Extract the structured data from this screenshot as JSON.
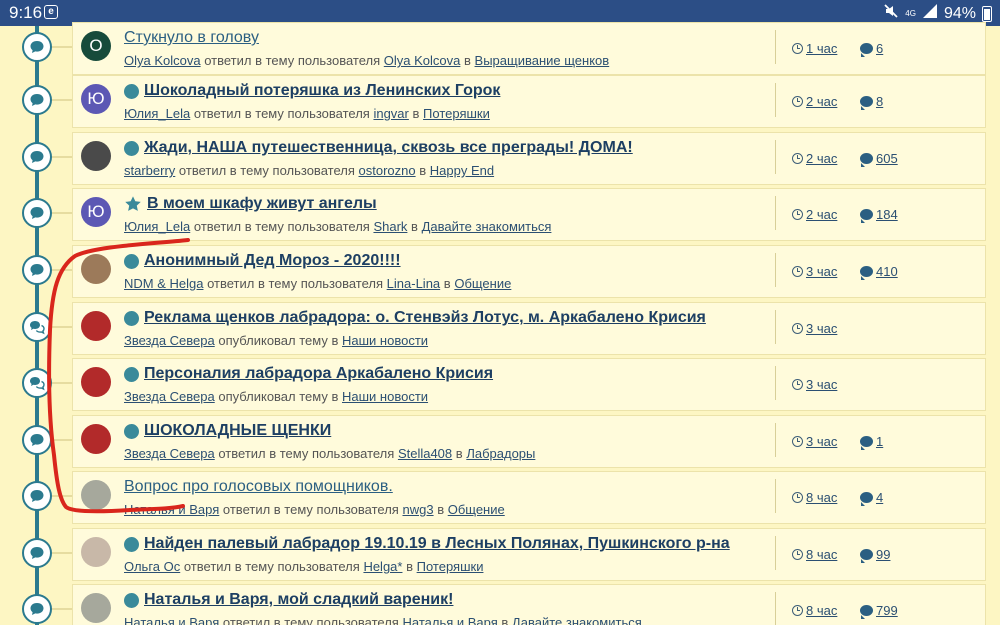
{
  "status_bar": {
    "time": "9:16",
    "app_icon": "e",
    "network": "4G",
    "battery": "94%",
    "icons": [
      "app-notification-icon",
      "mute-icon",
      "signal-icon",
      "battery-icon"
    ]
  },
  "colors": {
    "background": "#fdf6c3",
    "card": "#fffbdb",
    "timeline": "#2b7a8e",
    "status_bar": "#2c4e86",
    "annotation": "#d9261c"
  },
  "topics": [
    {
      "title": "Стукнуло в голову",
      "title_style": "normal",
      "marker": "none",
      "avatar_letter": "O",
      "avatar_color": "#174b3b",
      "author": "Olya Kolcova",
      "action": "ответил в тему пользователя",
      "topic_owner": "Olya Kolcova",
      "in_word": "в",
      "forum": "Выращивание щенков",
      "time": "1 час",
      "replies": "6",
      "node_icon": "comment-icon"
    },
    {
      "title": "Шоколадный потеряшка из Ленинских Горок",
      "title_style": "bold",
      "marker": "dot",
      "avatar_letter": "Ю",
      "avatar_color": "#5c58b4",
      "author": "Юлия_Lela",
      "action": "ответил в тему пользователя",
      "topic_owner": "ingvar",
      "in_word": "в",
      "forum": "Потеряшки",
      "time": "2 час",
      "replies": "8",
      "node_icon": "comment-icon"
    },
    {
      "title": "Жади, НАША путешественница, сквозь все преграды! ДОМА!",
      "title_style": "bold",
      "marker": "dot",
      "avatar_letter": "",
      "avatar_color": "#4a4a4a",
      "author": "starberry",
      "action": "ответил в тему пользователя",
      "topic_owner": "ostorozno",
      "in_word": "в",
      "forum": "Happy End",
      "time": "2 час",
      "replies": "605",
      "node_icon": "comment-icon"
    },
    {
      "title": "В моем шкафу живут ангелы",
      "title_style": "bold",
      "marker": "star",
      "avatar_letter": "Ю",
      "avatar_color": "#5c58b4",
      "author": "Юлия_Lela",
      "action": "ответил в тему пользователя",
      "topic_owner": "Shark",
      "in_word": "в",
      "forum": "Давайте знакомиться",
      "time": "2 час",
      "replies": "184",
      "node_icon": "comment-icon"
    },
    {
      "title": "Анонимный Дед Мороз - 2020!!!!",
      "title_style": "bold",
      "marker": "dot",
      "avatar_letter": "",
      "avatar_color": "#9c7a5a",
      "author": "NDM & Helga",
      "action": "ответил в тему пользователя",
      "topic_owner": "Lina-Lina",
      "in_word": "в",
      "forum": "Общение",
      "time": "3 час",
      "replies": "410",
      "node_icon": "comment-icon"
    },
    {
      "title": "Реклама щенков лабрадора: о. Стенвэйз Лотус, м. Аркабалено Крисия",
      "title_style": "bold",
      "marker": "dot",
      "avatar_letter": "",
      "avatar_color": "#b22a2a",
      "author": "Звезда Севера",
      "action": "опубликовал тему в",
      "topic_owner": "",
      "in_word": "",
      "forum": "Наши новости",
      "time": "3 час",
      "replies": "",
      "node_icon": "comments-icon"
    },
    {
      "title": "Персоналия лабрадора Аркабалено Крисия",
      "title_style": "bold",
      "marker": "dot",
      "avatar_letter": "",
      "avatar_color": "#b22a2a",
      "author": "Звезда Севера",
      "action": "опубликовал тему в",
      "topic_owner": "",
      "in_word": "",
      "forum": "Наши новости",
      "time": "3 час",
      "replies": "",
      "node_icon": "comments-icon"
    },
    {
      "title": "ШОКОЛАДНЫЕ ЩЕНКИ",
      "title_style": "bold",
      "marker": "dot",
      "avatar_letter": "",
      "avatar_color": "#b22a2a",
      "author": "Звезда Севера",
      "action": "ответил в тему пользователя",
      "topic_owner": "Stella408",
      "in_word": "в",
      "forum": "Лабрадоры",
      "time": "3 час",
      "replies": "1",
      "node_icon": "comment-icon"
    },
    {
      "title": "Вопрос про голосовых помощников.",
      "title_style": "normal",
      "marker": "none",
      "avatar_letter": "",
      "avatar_color": "#a6a89c",
      "author": "Наталья и Варя",
      "action": "ответил в тему пользователя",
      "topic_owner": "nwg3",
      "in_word": "в",
      "forum": "Общение",
      "time": "8 час",
      "replies": "4",
      "node_icon": "comment-icon"
    },
    {
      "title": "Найден палевый лабрадор 19.10.19 в Лесных Полянах, Пушкинского р-на",
      "title_style": "bold",
      "marker": "dot",
      "avatar_letter": "",
      "avatar_color": "#c8b8a8",
      "author": "Ольга Ос",
      "action": "ответил в тему пользователя",
      "topic_owner": "Helga*",
      "in_word": "в",
      "forum": "Потеряшки",
      "time": "8 час",
      "replies": "99",
      "node_icon": "comment-icon"
    },
    {
      "title": "Наталья и Варя, мой сладкий вареник!",
      "title_style": "bold",
      "marker": "dot",
      "avatar_letter": "",
      "avatar_color": "#a6a89c",
      "author": "Наталья и Варя",
      "action": "ответил в тему пользователя",
      "topic_owner": "Наталья и Варя",
      "in_word": "в",
      "forum": "Давайте знакомиться",
      "time": "8 час",
      "replies": "799",
      "node_icon": "comment-icon"
    }
  ]
}
